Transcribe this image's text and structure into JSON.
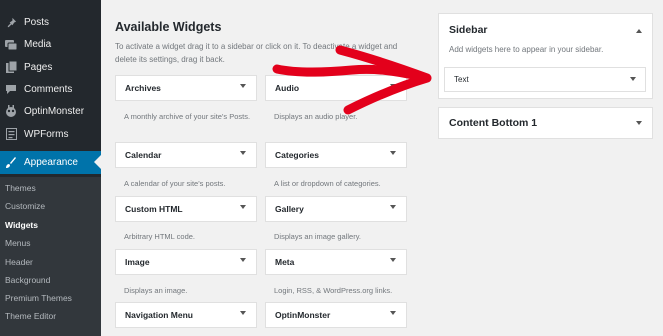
{
  "admin_menu": {
    "items": [
      {
        "label": "Posts",
        "icon": "pin-icon"
      },
      {
        "label": "Media",
        "icon": "media-icon"
      },
      {
        "label": "Pages",
        "icon": "pages-icon"
      },
      {
        "label": "Comments",
        "icon": "comments-icon"
      },
      {
        "label": "OptinMonster",
        "icon": "optinmonster-icon"
      },
      {
        "label": "WPForms",
        "icon": "wpforms-icon"
      },
      {
        "label": "Appearance",
        "icon": "brush-icon"
      }
    ],
    "submenu": [
      "Themes",
      "Customize",
      "Widgets",
      "Menus",
      "Header",
      "Background",
      "Premium Themes",
      "Theme Editor"
    ]
  },
  "available_widgets": {
    "title": "Available Widgets",
    "description": "To activate a widget drag it to a sidebar or click on it. To deactivate a widget and delete its settings, drag it back.",
    "widgets": [
      {
        "name": "Archives",
        "desc": "A monthly archive of your site's Posts."
      },
      {
        "name": "Audio",
        "desc": "Displays an audio player."
      },
      {
        "name": "Calendar",
        "desc": "A calendar of your site's posts."
      },
      {
        "name": "Categories",
        "desc": "A list or dropdown of categories."
      },
      {
        "name": "Custom HTML",
        "desc": "Arbitrary HTML code."
      },
      {
        "name": "Gallery",
        "desc": "Displays an image gallery."
      },
      {
        "name": "Image",
        "desc": "Displays an image."
      },
      {
        "name": "Meta",
        "desc": "Login, RSS, & WordPress.org links."
      },
      {
        "name": "Navigation Menu",
        "desc": ""
      },
      {
        "name": "OptinMonster",
        "desc": ""
      }
    ]
  },
  "sidebar_area": {
    "title": "Sidebar",
    "description": "Add widgets here to appear in your sidebar.",
    "widget": "Text"
  },
  "content_bottom": {
    "title": "Content Bottom 1"
  },
  "colors": {
    "admin_bar": "#23282d",
    "accent": "#0073aa",
    "arrow": "#e3001b"
  }
}
